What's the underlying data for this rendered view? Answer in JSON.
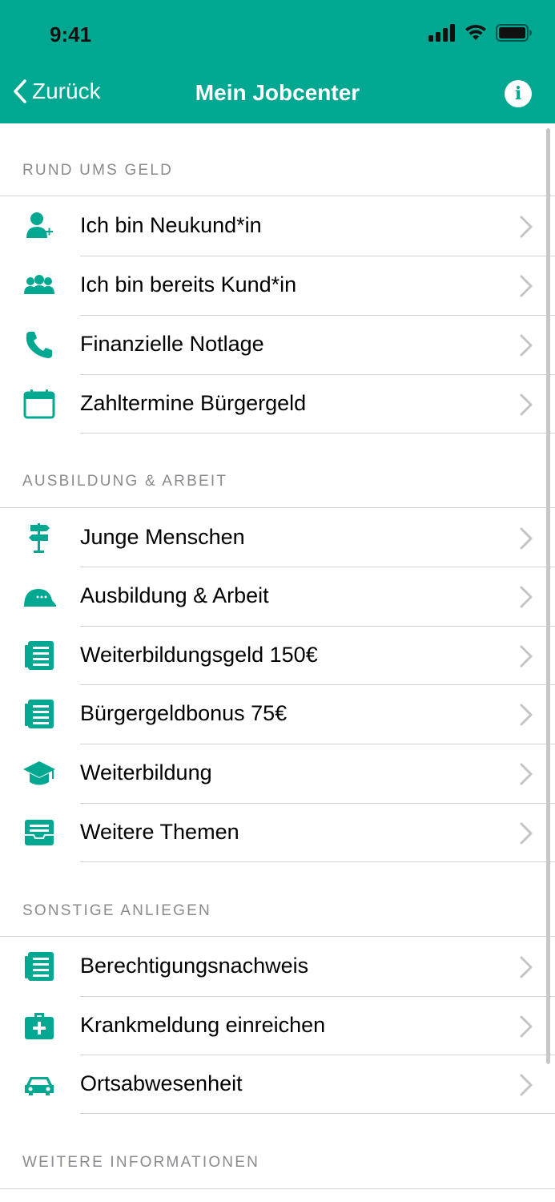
{
  "status_bar": {
    "time": "9:41"
  },
  "nav": {
    "back_label": "Zurück",
    "title": "Mein Jobcenter",
    "info_icon": "info-icon"
  },
  "colors": {
    "accent": "#00a891",
    "section_text": "#8a8a8e",
    "chevron": "#c4c4c8"
  },
  "sections": [
    {
      "title": "RUND UMS GELD",
      "items": [
        {
          "label": "Ich bin Neukund*in",
          "icon": "person-add-icon"
        },
        {
          "label": "Ich bin bereits Kund*in",
          "icon": "group-icon"
        },
        {
          "label": "Finanzielle Notlage",
          "icon": "phone-icon"
        },
        {
          "label": "Zahltermine Bürgergeld",
          "icon": "calendar-icon"
        }
      ]
    },
    {
      "title": "AUSBILDUNG & ARBEIT",
      "items": [
        {
          "label": "Junge Menschen",
          "icon": "signpost-icon"
        },
        {
          "label": "Ausbildung & Arbeit",
          "icon": "hard-hat-icon"
        },
        {
          "label": "Weiterbildungsgeld 150€",
          "icon": "document-list-icon"
        },
        {
          "label": "Bürgergeldbonus 75€",
          "icon": "document-list-icon"
        },
        {
          "label": "Weiterbildung",
          "icon": "graduation-cap-icon"
        },
        {
          "label": "Weitere Themen",
          "icon": "inbox-icon"
        }
      ]
    },
    {
      "title": "SONSTIGE ANLIEGEN",
      "items": [
        {
          "label": "Berechtigungsnachweis",
          "icon": "document-list-icon"
        },
        {
          "label": "Krankmeldung einreichen",
          "icon": "medical-kit-icon"
        },
        {
          "label": "Ortsabwesenheit",
          "icon": "car-icon"
        }
      ]
    },
    {
      "title": "WEITERE INFORMATIONEN",
      "items": []
    }
  ]
}
